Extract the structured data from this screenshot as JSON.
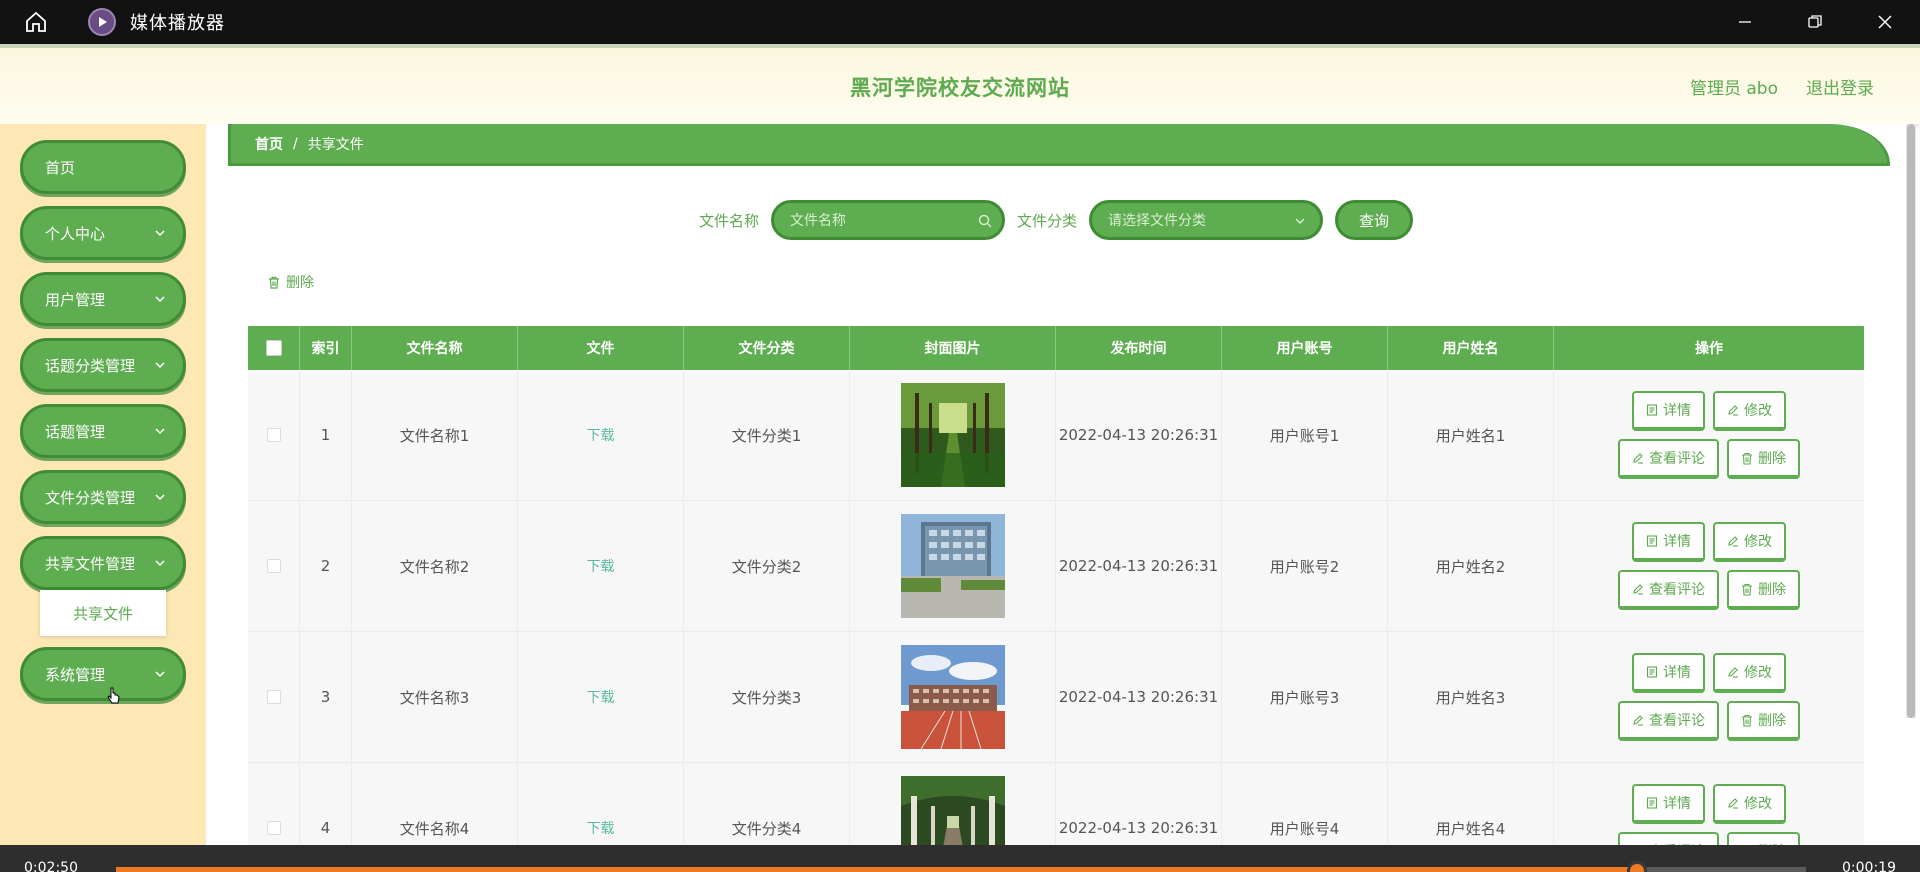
{
  "player": {
    "title": "媒体播放器",
    "time_elapsed": "0:02:50",
    "time_remaining": "0:00:19",
    "progress_fraction": 0.9,
    "accent_color": "#ef7a26"
  },
  "header": {
    "site_title": "黑河学院校友交流网站",
    "user_label": "管理员 abo",
    "logout_label": "退出登录",
    "brand_color": "#5daa4f"
  },
  "sidebar": {
    "items": [
      {
        "label": "首页"
      },
      {
        "label": "个人中心"
      },
      {
        "label": "用户管理"
      },
      {
        "label": "话题分类管理"
      },
      {
        "label": "话题管理"
      },
      {
        "label": "文件分类管理"
      },
      {
        "label": "共享文件管理"
      },
      {
        "label": "系统管理"
      }
    ],
    "sub_item": "共享文件"
  },
  "breadcrumb": {
    "home": "首页",
    "separator": "/",
    "current": "共享文件"
  },
  "search": {
    "name_label": "文件名称",
    "name_placeholder": "文件名称",
    "category_label": "文件分类",
    "category_placeholder": "请选择文件分类",
    "query_label": "查询"
  },
  "toolbar": {
    "delete_label": "删除"
  },
  "table": {
    "headers": [
      "",
      "索引",
      "文件名称",
      "文件",
      "文件分类",
      "封面图片",
      "发布时间",
      "用户账号",
      "用户姓名",
      "操作"
    ],
    "rows": [
      {
        "index": "1",
        "name": "文件名称1",
        "file": "下载",
        "category": "文件分类1",
        "time": "2022-04-13 20:26:31",
        "account": "用户账号1",
        "username": "用户姓名1"
      },
      {
        "index": "2",
        "name": "文件名称2",
        "file": "下载",
        "category": "文件分类2",
        "time": "2022-04-13 20:26:31",
        "account": "用户账号2",
        "username": "用户姓名2"
      },
      {
        "index": "3",
        "name": "文件名称3",
        "file": "下载",
        "category": "文件分类3",
        "time": "2022-04-13 20:26:31",
        "account": "用户账号3",
        "username": "用户姓名3"
      },
      {
        "index": "4",
        "name": "文件名称4",
        "file": "下载",
        "category": "文件分类4",
        "time": "2022-04-13 20:26:31",
        "account": "用户账号4",
        "username": "用户姓名4"
      }
    ],
    "actions": {
      "detail": "详情",
      "edit": "修改",
      "comments": "查看评论",
      "delete": "删除"
    }
  }
}
